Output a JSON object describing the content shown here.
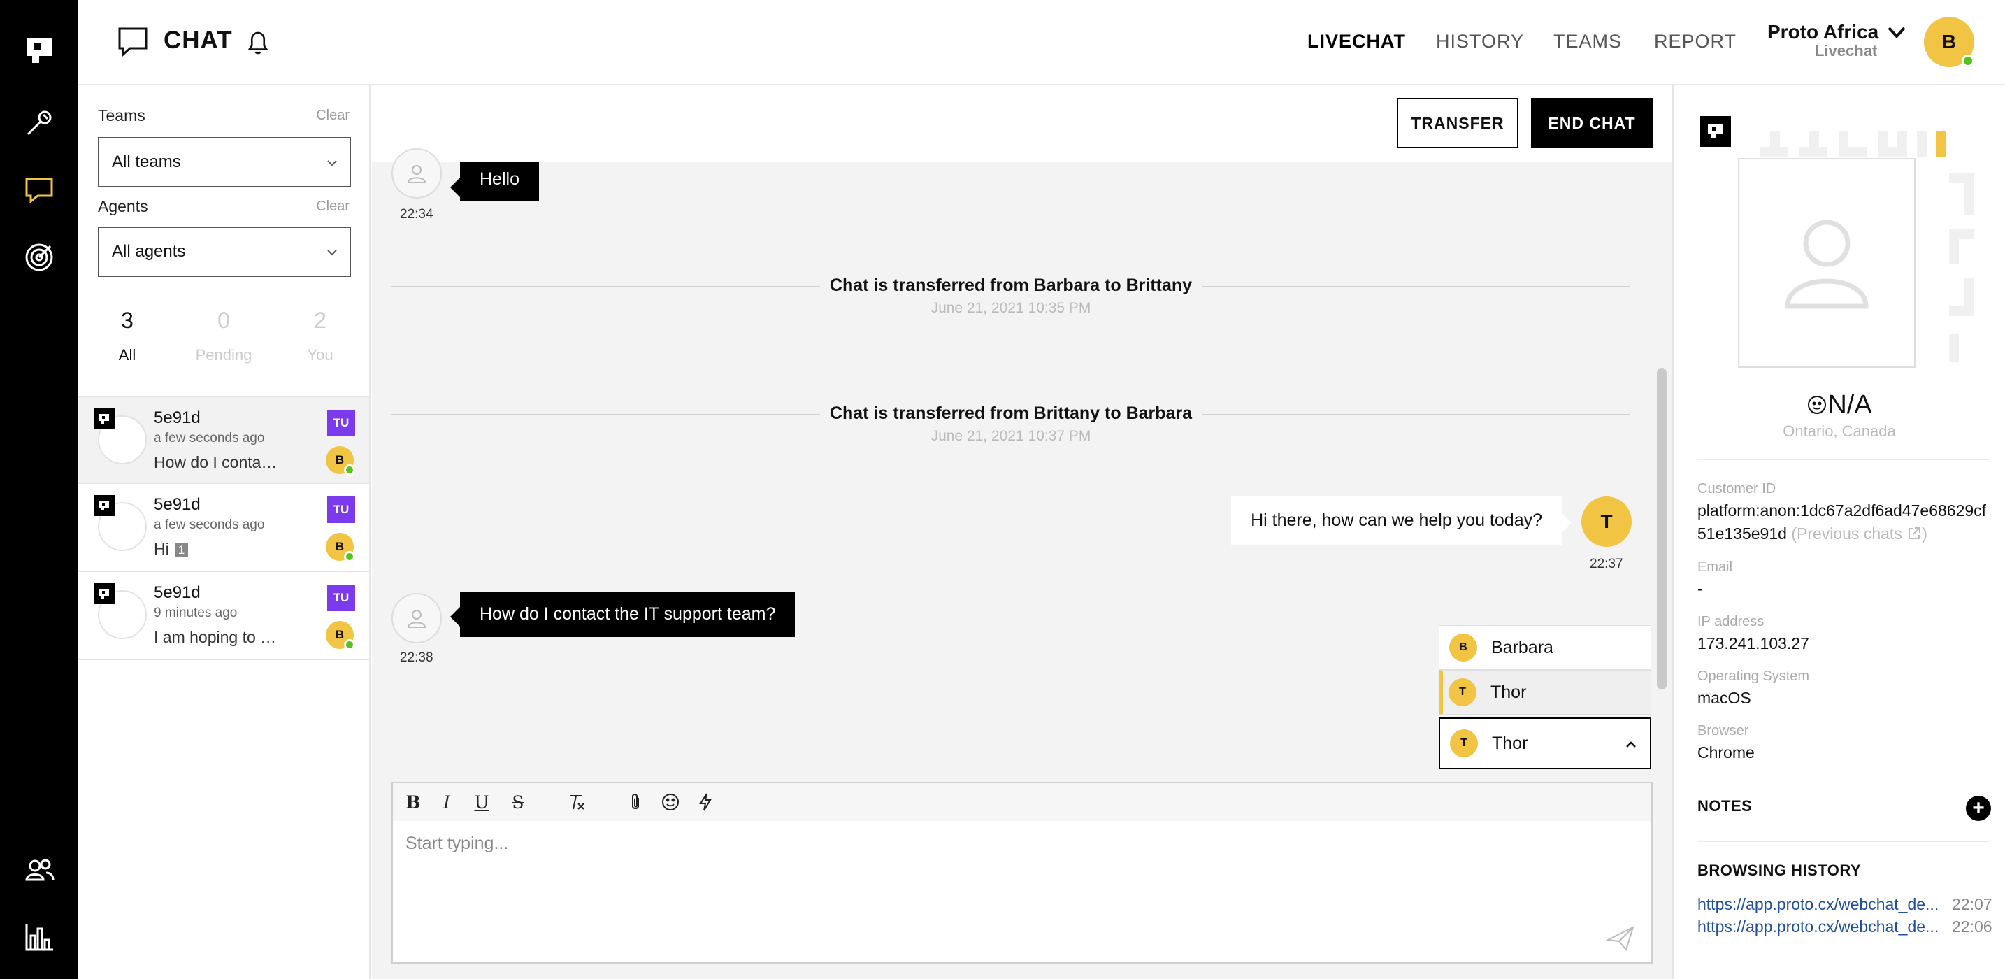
{
  "header": {
    "title": "CHAT",
    "nav": [
      "LIVECHAT",
      "HISTORY",
      "TEAMS",
      "REPORT"
    ],
    "active_nav": "LIVECHAT",
    "org_name": "Proto Africa",
    "org_sub": "Livechat",
    "user_initial": "B"
  },
  "filters": {
    "teams_label": "Teams",
    "teams_clear": "Clear",
    "teams_value": "All teams",
    "agents_label": "Agents",
    "agents_clear": "Clear",
    "agents_value": "All agents"
  },
  "counters": [
    {
      "num": "3",
      "label": "All"
    },
    {
      "num": "0",
      "label": "Pending"
    },
    {
      "num": "2",
      "label": "You"
    }
  ],
  "chat_list": [
    {
      "name": "5e91d",
      "time": "a few seconds ago",
      "message": "How do I contact the IT support team?",
      "team_badge": "TU",
      "agent": "B"
    },
    {
      "name": "5e91d",
      "time": "a few seconds ago",
      "message": "Hi",
      "unread": "1",
      "team_badge": "TU",
      "agent": "B"
    },
    {
      "name": "5e91d",
      "time": "9 minutes ago",
      "message": "I am hoping to come in",
      "team_badge": "TU",
      "agent": "B"
    }
  ],
  "actions": {
    "transfer": "TRANSFER",
    "end_chat": "END CHAT"
  },
  "messages": {
    "m1": {
      "text": "Hello",
      "time": "22:34"
    },
    "sys1": {
      "text": "Chat is transferred from Barbara to Brittany",
      "date": "June 21, 2021 10:35 PM"
    },
    "sys2": {
      "text": "Chat is transferred from Brittany to Barbara",
      "date": "June 21, 2021 10:37 PM"
    },
    "m2": {
      "text": "Hi there, how can we help you today?",
      "time": "22:37",
      "agent": "T"
    },
    "m3": {
      "text": "How do I contact the IT support team?",
      "time": "22:38"
    }
  },
  "agent_dropdown": {
    "options": [
      {
        "initial": "B",
        "name": "Barbara"
      },
      {
        "initial": "T",
        "name": "Thor"
      }
    ],
    "selected": {
      "initial": "T",
      "name": "Thor"
    }
  },
  "composer": {
    "placeholder": "Start typing..."
  },
  "customer": {
    "name": "N/A",
    "location": "Ontario, Canada",
    "customer_id_label": "Customer ID",
    "customer_id": "platform:anon:1dc67a2df6ad47e68629cf51e135e91d",
    "previous_chats": "(Previous chats",
    "previous_chats_end": ")",
    "email_label": "Email",
    "email": "-",
    "ip_label": "IP address",
    "ip": "173.241.103.27",
    "os_label": "Operating System",
    "os": "macOS",
    "browser_label": "Browser",
    "browser": "Chrome",
    "notes_label": "NOTES",
    "history_label": "BROWSING HISTORY",
    "history": [
      {
        "url": "https://app.proto.cx/webchat_de...",
        "time": "22:07"
      },
      {
        "url": "https://app.proto.cx/webchat_de...",
        "time": "22:06"
      }
    ]
  },
  "colors": {
    "accent": "#f2c443",
    "team_badge": "#7c3aed",
    "link": "#1f4fa0",
    "online": "#52c41a"
  }
}
